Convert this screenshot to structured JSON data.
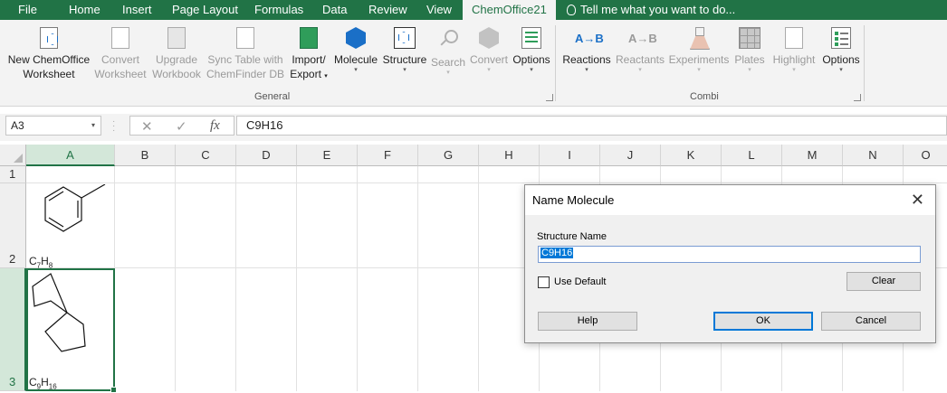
{
  "tabs": {
    "file": "File",
    "home": "Home",
    "insert": "Insert",
    "page_layout": "Page Layout",
    "formulas": "Formulas",
    "data": "Data",
    "review": "Review",
    "view": "View",
    "chemoffice": "ChemOffice21",
    "tell_me": "Tell me what you want to do..."
  },
  "ribbon": {
    "new_ws": [
      "New ChemOffice",
      "Worksheet"
    ],
    "convert_ws": [
      "Convert",
      "Worksheet"
    ],
    "upgrade_wb": [
      "Upgrade",
      "Workbook"
    ],
    "sync": [
      "Sync Table with",
      "ChemFinder DB"
    ],
    "import_export": [
      "Import/",
      "Export"
    ],
    "molecule": "Molecule",
    "structure": "Structure",
    "search": "Search",
    "convert": "Convert",
    "options1": "Options",
    "group_general": "General",
    "reactions": "Reactions",
    "reactants": "Reactants",
    "experiments": "Experiments",
    "plates": "Plates",
    "highlight": "Highlight",
    "options2": "Options",
    "group_combi": "Combi",
    "reaction_icon": "A→B"
  },
  "formula_bar": {
    "name_box": "A3",
    "cancel": "✕",
    "enter": "✓",
    "fx": "fx",
    "value": "C9H16"
  },
  "grid": {
    "columns": [
      "A",
      "B",
      "C",
      "D",
      "E",
      "F",
      "G",
      "H",
      "I",
      "J",
      "K",
      "L",
      "M",
      "N",
      "O"
    ],
    "rows": [
      "1",
      "2",
      "3"
    ],
    "cells": {
      "a2": {
        "base": [
          "C",
          "H"
        ],
        "sub": [
          "7",
          "8"
        ]
      },
      "a3": {
        "base": [
          "C",
          "H"
        ],
        "sub": [
          "9",
          "16"
        ]
      }
    }
  },
  "dialog": {
    "title": "Name Molecule",
    "close": "✕",
    "structure_name_label": "Structure Name",
    "structure_name_value": "C9H16",
    "use_default": "Use Default",
    "clear": "Clear",
    "help": "Help",
    "ok": "OK",
    "cancel": "Cancel"
  },
  "colors": {
    "excel_green": "#217346",
    "selection_blue": "#0078d7"
  }
}
